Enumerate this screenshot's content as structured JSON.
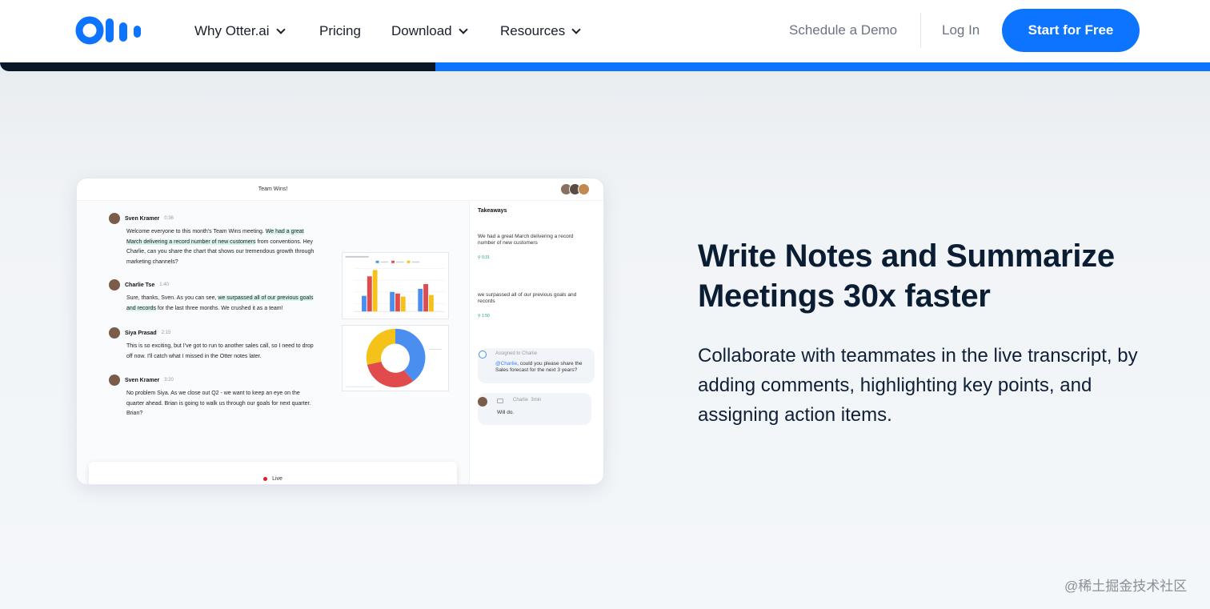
{
  "header": {
    "nav": [
      {
        "label": "Why Otter.ai",
        "has_dropdown": true
      },
      {
        "label": "Pricing",
        "has_dropdown": false
      },
      {
        "label": "Download",
        "has_dropdown": true
      },
      {
        "label": "Resources",
        "has_dropdown": true
      }
    ],
    "schedule_demo": "Schedule a Demo",
    "login": "Log In",
    "cta": "Start for Free"
  },
  "progress": {
    "fraction": 0.36
  },
  "colors": {
    "brand_blue": "#0d74ff",
    "navy": "#0a1d33",
    "highlight": "#d6f3ec",
    "live_red": "#e02020"
  },
  "mock": {
    "title": "Team Wins!",
    "transcript": [
      {
        "name": "Sven Kramer",
        "time": "0:36",
        "parts": [
          {
            "text": "Welcome everyone to this month's Team Wins meeting. ",
            "hl": false
          },
          {
            "text": "We had a great March delivering a record number of new customers",
            "hl": true
          },
          {
            "text": " from conventions. Hey Charlie, can you share the chart that shows our tremendous growth through marketing channels?",
            "hl": false
          }
        ]
      },
      {
        "name": "Charlie Tse",
        "time": "1:40",
        "parts": [
          {
            "text": "Sure, thanks, Sven. As you can see, ",
            "hl": false
          },
          {
            "text": "we surpassed all of our previous goals and records",
            "hl": true
          },
          {
            "text": " for the last three months. We crushed it as a team!",
            "hl": false
          }
        ]
      },
      {
        "name": "Siya Prasad",
        "time": "2:15",
        "parts": [
          {
            "text": "This is so exciting, but I've got to run to another sales call, so I need to drop off now. I'll catch what I missed in the Otter notes later.",
            "hl": false
          }
        ]
      },
      {
        "name": "Sven Kramer",
        "time": "3:20",
        "parts": [
          {
            "text": "No problem Siya. As we close out Q2 - we want to keep an eye on the quarter ahead. Brian is going to walk us through our goals for next quarter. Brian?",
            "hl": false
          }
        ]
      }
    ],
    "live_label": "Live",
    "takeaways": {
      "title": "Takeaways",
      "items": [
        {
          "text": "We had a great March delivering a record number of new customers",
          "time": "0:31"
        },
        {
          "text": "we surpassed all of our previous goals and records",
          "time": "1:50"
        }
      ],
      "assigned_label": "Assigned to Charlie",
      "assigned_mention": "@Charlie",
      "assigned_text": ", could you please share the Sales forecast for the next 3 years?",
      "comment_author": "Charlie",
      "comment_age": "3min",
      "comment_text": "Will do."
    }
  },
  "hero": {
    "heading": "Write Notes and Summarize Meetings 30x faster",
    "body": "Collaborate with teammates in the live transcript, by adding comments, highlighting key points, and assigning action items."
  },
  "watermark": "@稀土掘金技术社区"
}
